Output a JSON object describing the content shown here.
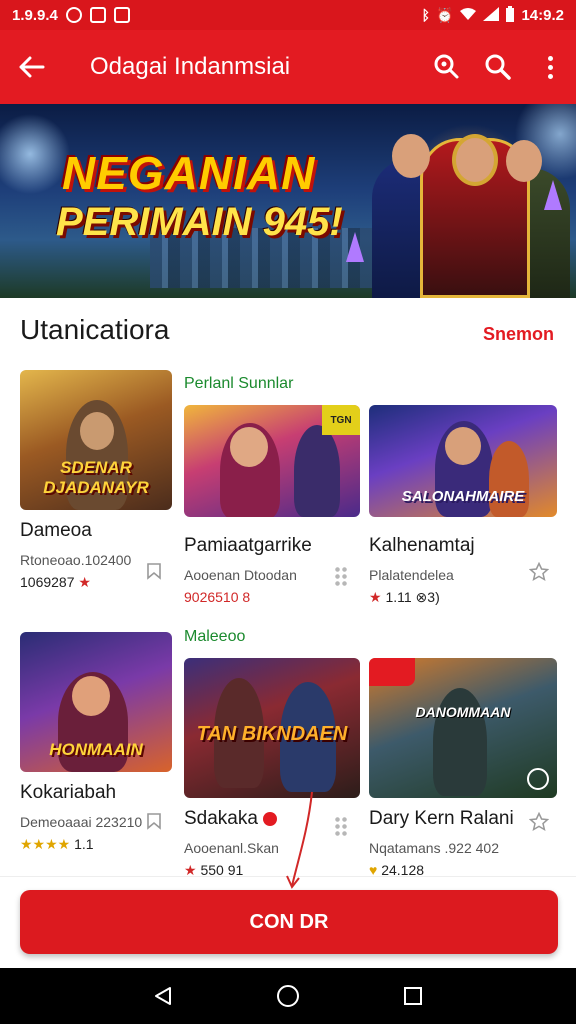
{
  "status_bar": {
    "left_text": "1.9.9.4",
    "time": "14:9.2",
    "icons": [
      "notification-icon",
      "mail-icon",
      "gallery-icon",
      "bluetooth-icon",
      "alarm-icon",
      "wifi-icon",
      "signal-icon",
      "battery-icon"
    ]
  },
  "app_bar": {
    "title": "Odagai Indanmsiai",
    "back_icon": "back-arrow-icon",
    "actions": [
      "location-search-icon",
      "search-icon",
      "more-vert-icon"
    ]
  },
  "banner": {
    "line1": "NEGANIAN",
    "line2": "PERIMAIN 945!"
  },
  "section": {
    "title": "Utanicatiora",
    "link": "Snemon"
  },
  "sub_labels": {
    "row1": "Perlanl Sunnlar",
    "row2": "Maleeoo"
  },
  "cards": [
    {
      "name": "Dameoa",
      "meta": "Rtoneoao.102400",
      "rating": "1069287",
      "stars": "★",
      "art_title": "SDENAR DJADANAYR",
      "side_icon": "bookmark-icon"
    },
    {
      "name": "Pamiaatgarrike",
      "meta": "Aooenan Dtoodan",
      "rating": "9026510 8",
      "stars": "",
      "art_title": "",
      "badge": "TGN",
      "side_icon": "drag-handle-icon"
    },
    {
      "name": "Kalhenamtaj",
      "meta": "Plalatendelea",
      "rating": "1.11 ⊗3)",
      "stars": "★",
      "art_title": "SALONAHMAIRE",
      "side_icon": "star-outline-icon"
    },
    {
      "name": "Kokariabah",
      "meta": "Demeoaaai 223210",
      "rating": "1.1",
      "stars": "★★★★",
      "art_title": "HONMAAIN",
      "side_icon": "bookmark-icon"
    },
    {
      "name": "Sdakaka",
      "meta": "Aooenanl.Skan",
      "rating": "550 91",
      "stars": "★",
      "art_title": "TAN BIKNDAEN",
      "side_icon": "drag-handle-icon"
    },
    {
      "name": "Dary Kern Ralani",
      "meta": "Nqatamans .922 402",
      "rating": "24.128",
      "stars": "♥",
      "art_title": "DANOMMAAN",
      "side_icon": "star-outline-icon"
    }
  ],
  "primary_button": {
    "label": "CON DR"
  },
  "nav": {
    "icons": [
      "back-triangle-icon",
      "home-circle-icon",
      "recents-square-icon"
    ]
  },
  "colors": {
    "brand": "#e31b22",
    "status": "#d9161c",
    "star_red": "#d12828",
    "star_gold": "#e0a500"
  }
}
